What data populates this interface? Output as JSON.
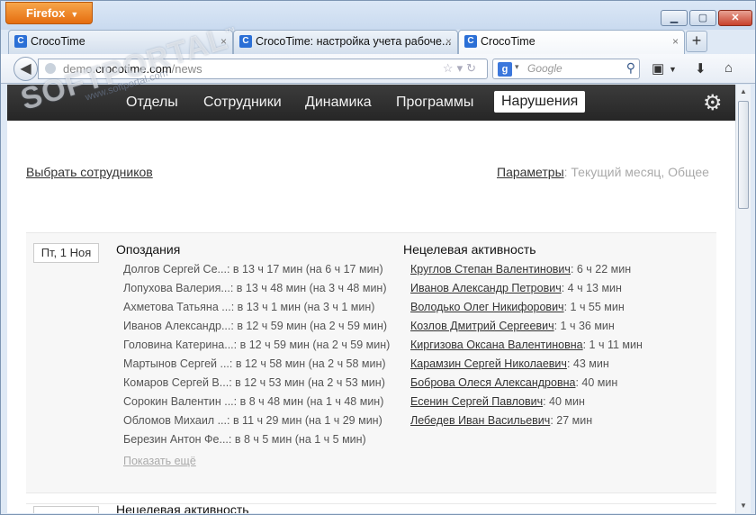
{
  "browser": {
    "menu_button": "Firefox",
    "window_controls": {
      "minimize": "▁",
      "maximize": "▢",
      "close": "✕"
    },
    "tabs": [
      {
        "title": "CrocoTime",
        "active": false
      },
      {
        "title": "CrocoTime: настройка учета рабоче...",
        "active": false
      },
      {
        "title": "CrocoTime",
        "active": true
      }
    ],
    "tab_close": "×",
    "new_tab": "+",
    "url": {
      "prefix": "demo.",
      "host": "crocotime.com",
      "path": "/news"
    },
    "search": {
      "engine": "g",
      "placeholder": "Google"
    }
  },
  "watermark": {
    "text": "SOFTPORTAL",
    "tm": "™",
    "url": "www.softportal.com"
  },
  "app": {
    "nav": [
      "Отделы",
      "Сотрудники",
      "Динамика",
      "Программы",
      "Нарушения"
    ],
    "active_nav": "Нарушения",
    "choose_employees": "Выбрать сотрудников",
    "params_label": "Параметры",
    "params_value": ": Текущий месяц, Общее",
    "day": {
      "date": "Пт, 1 Ноя",
      "late_title": "Опоздания",
      "activity_title": "Нецелевая активность",
      "late": [
        {
          "name": "Долгов Сергей Се...",
          "value": ": в 13 ч 17 мин (на 6 ч 17 мин)"
        },
        {
          "name": "Лопухова Валерия...",
          "value": ": в 13 ч 48 мин (на 3 ч 48 мин)"
        },
        {
          "name": "Ахметова Татьяна ...",
          "value": ": в 13 ч 1 мин (на 3 ч 1 мин)"
        },
        {
          "name": "Иванов Александр...",
          "value": ": в 12 ч 59 мин (на 2 ч 59 мин)"
        },
        {
          "name": "Головина Катерина...",
          "value": ": в 12 ч 59 мин (на 2 ч 59 мин)"
        },
        {
          "name": "Мартынов Сергей ...",
          "value": ": в 12 ч 58 мин (на 2 ч 58 мин)"
        },
        {
          "name": "Комаров Сергей В...",
          "value": ": в 12 ч 53 мин (на 2 ч 53 мин)"
        },
        {
          "name": "Сорокин Валентин ...",
          "value": ": в 8 ч 48 мин (на 1 ч 48 мин)"
        },
        {
          "name": "Обломов Михаил ...",
          "value": ": в 11 ч 29 мин (на 1 ч 29 мин)"
        },
        {
          "name": "Березин Антон Фе...",
          "value": ": в 8 ч 5 мин (на 1 ч 5 мин)"
        }
      ],
      "activity": [
        {
          "name": "Круглов Степан Валентинович",
          "value": ": 6 ч 22 мин"
        },
        {
          "name": "Иванов Александр Петрович",
          "value": ": 4 ч 13 мин"
        },
        {
          "name": "Володько Олег Никифорович",
          "value": ": 1 ч 55 мин"
        },
        {
          "name": "Козлов Дмитрий Сергеевич",
          "value": ": 1 ч 36 мин"
        },
        {
          "name": "Киргизова Оксана Валентиновна",
          "value": ": 1 ч 11 мин"
        },
        {
          "name": "Карамзин Сергей Николаевич",
          "value": ": 43 мин"
        },
        {
          "name": "Боброва Олеся Александровна",
          "value": ": 40 мин"
        },
        {
          "name": "Есенин Сергей Павлович",
          "value": ": 40 мин"
        },
        {
          "name": "Лебедев Иван Васильевич",
          "value": ": 27 мин"
        }
      ],
      "show_more": "Показать ещё"
    },
    "next_day_title": "Нецелевая активность"
  }
}
